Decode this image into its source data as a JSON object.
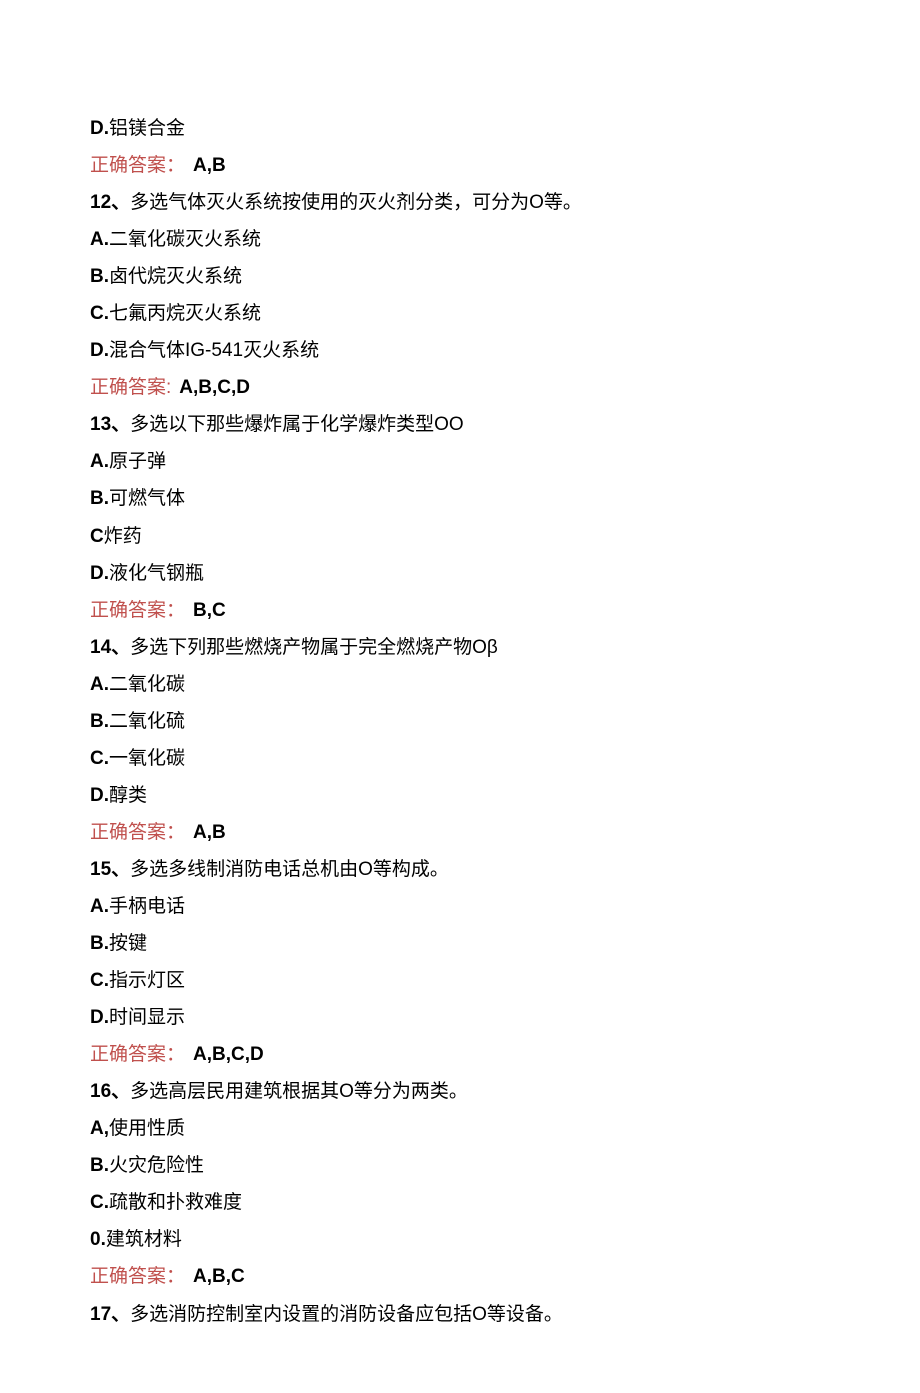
{
  "q11": {
    "optD_label": "D.",
    "optD_text": "铝镁合金",
    "answer_label": "正确答案：",
    "answer_value": "A,B"
  },
  "q12": {
    "num": "12、",
    "stem": "多选气体灭火系统按使用的灭火剂分类，可分为O等。",
    "optA_label": "A.",
    "optA_text": "二氧化碳灭火系统",
    "optB_label": "B.",
    "optB_text": "卤代烷灭火系统",
    "optC_label": "C.",
    "optC_text": "七氟丙烷灭火系统",
    "optD_label": "D.",
    "optD_text": "混合气体IG-541灭火系统",
    "answer_label": "正确答案:",
    "answer_value": "A,B,C,D"
  },
  "q13": {
    "num": "13、",
    "stem": "多选以下那些爆炸属于化学爆炸类型OO",
    "optA_label": "A.",
    "optA_text": "原子弹",
    "optB_label": "B.",
    "optB_text": "可燃气体",
    "optC_label": "C",
    "optC_text": "炸药",
    "optD_label": "D.",
    "optD_text": "液化气钢瓶",
    "answer_label": "正确答案：",
    "answer_value": "B,C"
  },
  "q14": {
    "num": "14、",
    "stem": "多选下列那些燃烧产物属于完全燃烧产物Oβ",
    "optA_label": "A.",
    "optA_text": "二氧化碳",
    "optB_label": "B.",
    "optB_text": "二氧化硫",
    "optC_label": "C.",
    "optC_text": "一氧化碳",
    "optD_label": "D.",
    "optD_text": "醇类",
    "answer_label": "正确答案：",
    "answer_value": "A,B"
  },
  "q15": {
    "num": "15、",
    "stem": "多选多线制消防电话总机由O等构成。",
    "optA_label": "A.",
    "optA_text": "手柄电话",
    "optB_label": "B.",
    "optB_text": "按键",
    "optC_label": "C.",
    "optC_text": "指示灯区",
    "optD_label": "D.",
    "optD_text": "时间显示",
    "answer_label": "正确答案：",
    "answer_value": "A,B,C,D"
  },
  "q16": {
    "num": "16、",
    "stem": "多选高层民用建筑根据其O等分为两类。",
    "optA_label": "A,",
    "optA_text": "使用性质",
    "optB_label": "B.",
    "optB_text": "火灾危险性",
    "optC_label": "C.",
    "optC_text": "疏散和扑救难度",
    "optD_label": "0.",
    "optD_text": "建筑材料",
    "answer_label": "正确答案：",
    "answer_value": "A,B,C"
  },
  "q17": {
    "num": "17、",
    "stem": "多选消防控制室内设置的消防设备应包括O等设备。"
  }
}
